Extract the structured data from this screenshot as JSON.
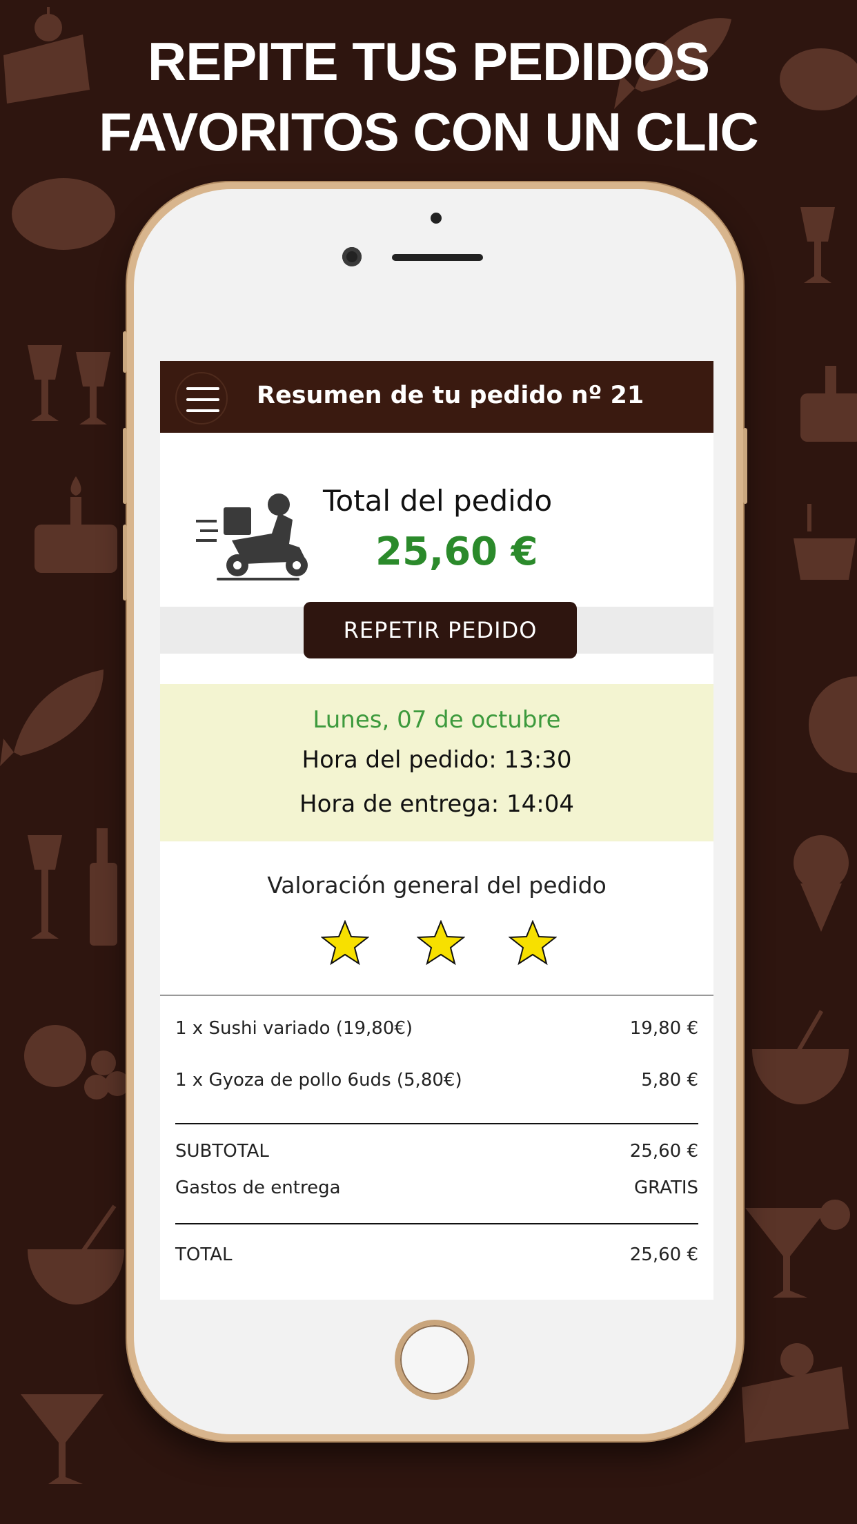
{
  "headline": {
    "line1": "REPITE TUS PEDIDOS",
    "line2": "FAVORITOS CON UN CLIC"
  },
  "app": {
    "title": "Resumen de tu pedido nº 21",
    "menu_icon": "hamburger-menu-icon"
  },
  "summary": {
    "total_label": "Total del pedido",
    "total_value": "25,60 €",
    "delivery_icon": "delivery-scooter-icon",
    "repeat_button": "REPETIR PEDIDO"
  },
  "schedule": {
    "date": "Lunes, 07 de octubre",
    "order_time": "Hora del pedido: 13:30",
    "delivery_time": "Hora de entrega: 14:04"
  },
  "rating": {
    "title": "Valoración general del pedido",
    "stars": 3
  },
  "items": [
    {
      "name": "1 x Sushi variado (19,80€)",
      "price": "19,80 €"
    },
    {
      "name": "1 x Gyoza de pollo 6uds (5,80€)",
      "price": "5,80 €"
    }
  ],
  "totals": {
    "subtotal_label": "SUBTOTAL",
    "subtotal_value": "25,60 €",
    "delivery_label": "Gastos de entrega",
    "delivery_value": "GRATIS",
    "total_label": "TOTAL",
    "total_value": "25,60 €"
  },
  "colors": {
    "background": "#2e150f",
    "header_bar": "#3a1a10",
    "price_green": "#2b8a2b",
    "date_green": "#3d9a3d",
    "date_panel": "#f3f4d1",
    "star": "#f7e000"
  }
}
